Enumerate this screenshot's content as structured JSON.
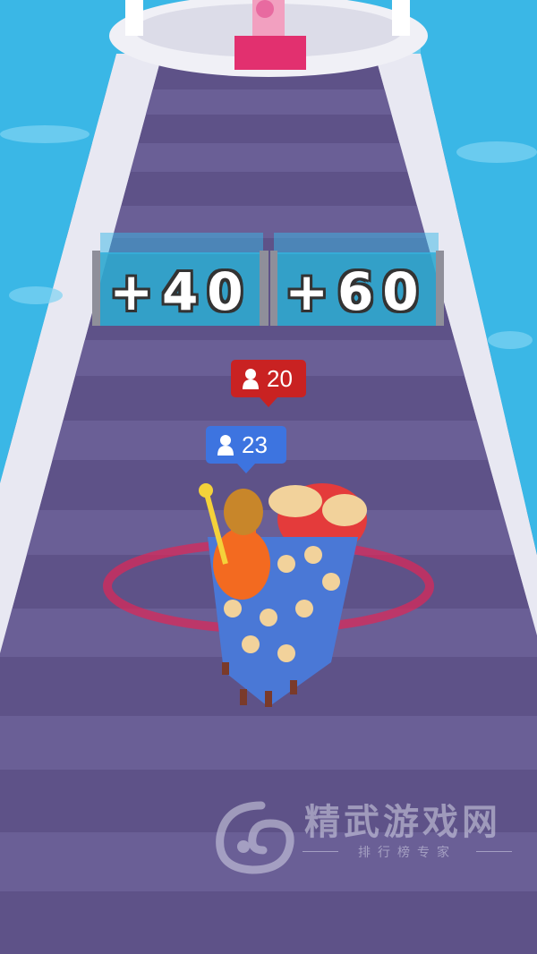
{
  "gates": [
    {
      "label": "+40"
    },
    {
      "label": "+60"
    }
  ],
  "enemy_crowd": {
    "count": "20",
    "color": "#c92222",
    "icon": "person-icon"
  },
  "player_crowd": {
    "count": "23",
    "color": "#3d74e0",
    "icon": "person-icon"
  },
  "watermark": {
    "title": "精武游戏网",
    "subtitle": "排行榜专家"
  },
  "colors": {
    "water": "#3ab7e6",
    "track": "#5e5288",
    "rail": "#e8e8f2",
    "gate": "#2fa9cf",
    "throne_carpet": "#e2306f"
  }
}
